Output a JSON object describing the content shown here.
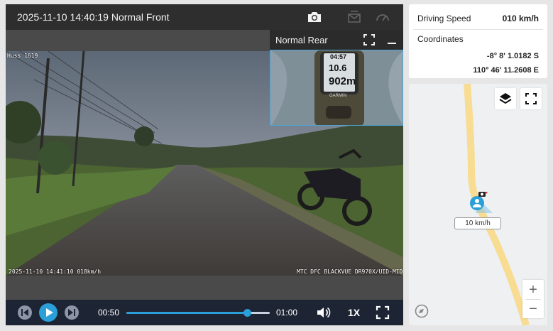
{
  "front_camera": {
    "title": "2025-11-10 14:40:19 Normal Front",
    "overlay_left": "Huss 1619",
    "overlay_bottom_left": "2025-11-10 14:41:10 018km/h",
    "overlay_bottom_right": "MTC DFC BLACKVUE DR970X/UID-MID"
  },
  "rear_camera": {
    "title": "Normal Rear",
    "gps_time": "04:57",
    "gps_speed": "10.6",
    "gps_distance": "902m",
    "gps_brand": "GARMIN"
  },
  "player": {
    "current_time": "00:50",
    "total_time": "01:00",
    "progress": 0.84,
    "speed_rate": "1X"
  },
  "info": {
    "driving_speed_label": "Driving Speed",
    "driving_speed_value": "010 km/h",
    "coordinates_label": "Coordinates",
    "latitude": "-8° 8' 1.0182 S",
    "longitude": "110° 46' 11.2608 E"
  },
  "map": {
    "speed_label": "10 km/h",
    "zoom_in": "+",
    "zoom_out": "−"
  },
  "colors": {
    "accent": "#2a9fd8",
    "control_bar": "#1d2433",
    "road": "#f7dc92",
    "map_bg": "#eef0f2"
  },
  "icons": [
    "camera-icon",
    "email-icon",
    "gauge-icon",
    "expand-icon",
    "minimize-icon",
    "skip-back-icon",
    "play-icon",
    "skip-forward-icon",
    "volume-icon",
    "fullscreen-icon",
    "layers-icon",
    "map-fullscreen-icon",
    "compass-icon",
    "person-marker-icon"
  ]
}
